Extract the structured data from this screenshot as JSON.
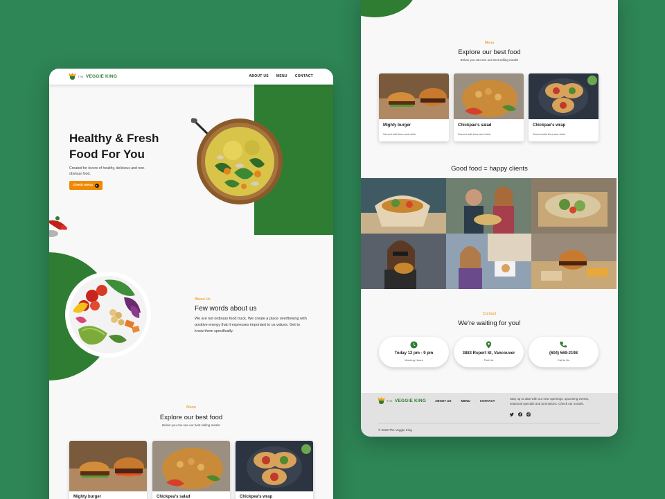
{
  "brand": {
    "small": "THE",
    "big": "VEGGIE KING"
  },
  "nav": {
    "about": "ABOUT US",
    "menu": "MENU",
    "contact": "CONTACT"
  },
  "hero": {
    "title": "Healthy & Fresh Food For You",
    "subtitle": "Created for lovers of healthy, delicious and non-obvious food.",
    "cta": "Check menu"
  },
  "about": {
    "kicker": "About Us",
    "title": "Few words about us",
    "text": "We are not ordinary food truck. We create a place overflowing with positive energy that it expresses important to us values. Get to know them specifically."
  },
  "menu": {
    "kicker": "Menu",
    "title": "Explore our best food",
    "subtitle": "Below you can see our best selling meals!",
    "items": [
      {
        "name": "Mighty burger",
        "desc": "Served with fries and drink"
      },
      {
        "name": "Chickpae's salad",
        "desc": "Served with fries and drink"
      },
      {
        "name": "Chickpae's wrap",
        "desc": "Served with fries and drink"
      }
    ]
  },
  "left_menu_items": [
    {
      "name": "Mighty burger"
    },
    {
      "name": "Chickpea's salad"
    },
    {
      "name": "Chickpea's wrap"
    }
  ],
  "clients": {
    "title": "Good food = happy clients"
  },
  "contact": {
    "kicker": "Contact",
    "title": "We're waiting for you!",
    "cards": [
      {
        "icon": "clock-icon",
        "main": "Today 12 pm - 9 pm",
        "label": "Working Hours"
      },
      {
        "icon": "location-pin-icon",
        "main": "3883 Rupert St, Vancouver",
        "label": "Find Us"
      },
      {
        "icon": "phone-icon",
        "main": "(604) 569-2198",
        "label": "Call to Us"
      }
    ]
  },
  "footer": {
    "links": [
      "ABOUT US",
      "MENU",
      "CONTACT"
    ],
    "text": "Stay up to date with our new openings, upcoming events, seasonal specials and promotions. Check our socials.",
    "social": [
      "twitter-icon",
      "facebook-icon",
      "instagram-icon"
    ],
    "copyright": "© 2023 The Veggie King"
  },
  "colors": {
    "background": "#2e8556",
    "brand_green": "#2f7d32",
    "accent_orange": "#f08a00"
  }
}
